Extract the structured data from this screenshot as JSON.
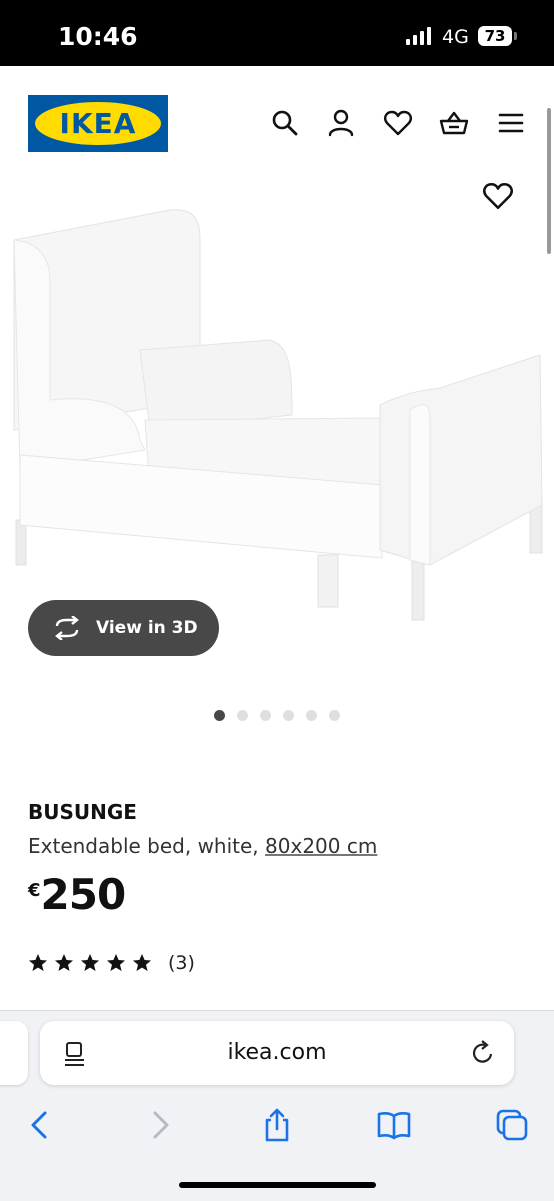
{
  "status_bar": {
    "time": "10:46",
    "network": "4G",
    "battery": "73"
  },
  "header": {
    "logo_text": "IKEA",
    "icons": [
      "search-icon",
      "user-icon",
      "heart-icon",
      "basket-icon",
      "menu-icon"
    ]
  },
  "gallery": {
    "view_3d_label": "View in 3D",
    "dot_count": 6,
    "active_dot": 0
  },
  "product": {
    "name": "BUSUNGE",
    "description_text": "Extendable bed, white,",
    "size_link": "80x200 cm",
    "currency": "€",
    "price": "250",
    "rating_stars": 5,
    "rating_count": "(3)"
  },
  "browser": {
    "url": "ikea.com",
    "toolbar_icons": [
      "back-icon",
      "forward-icon",
      "share-icon",
      "bookmarks-icon",
      "tabs-icon"
    ]
  },
  "colors": {
    "ikea_blue": "#0058a3",
    "ikea_yellow": "#ffdb00",
    "button_dark": "#484848",
    "browser_accent": "#1a73e8"
  }
}
